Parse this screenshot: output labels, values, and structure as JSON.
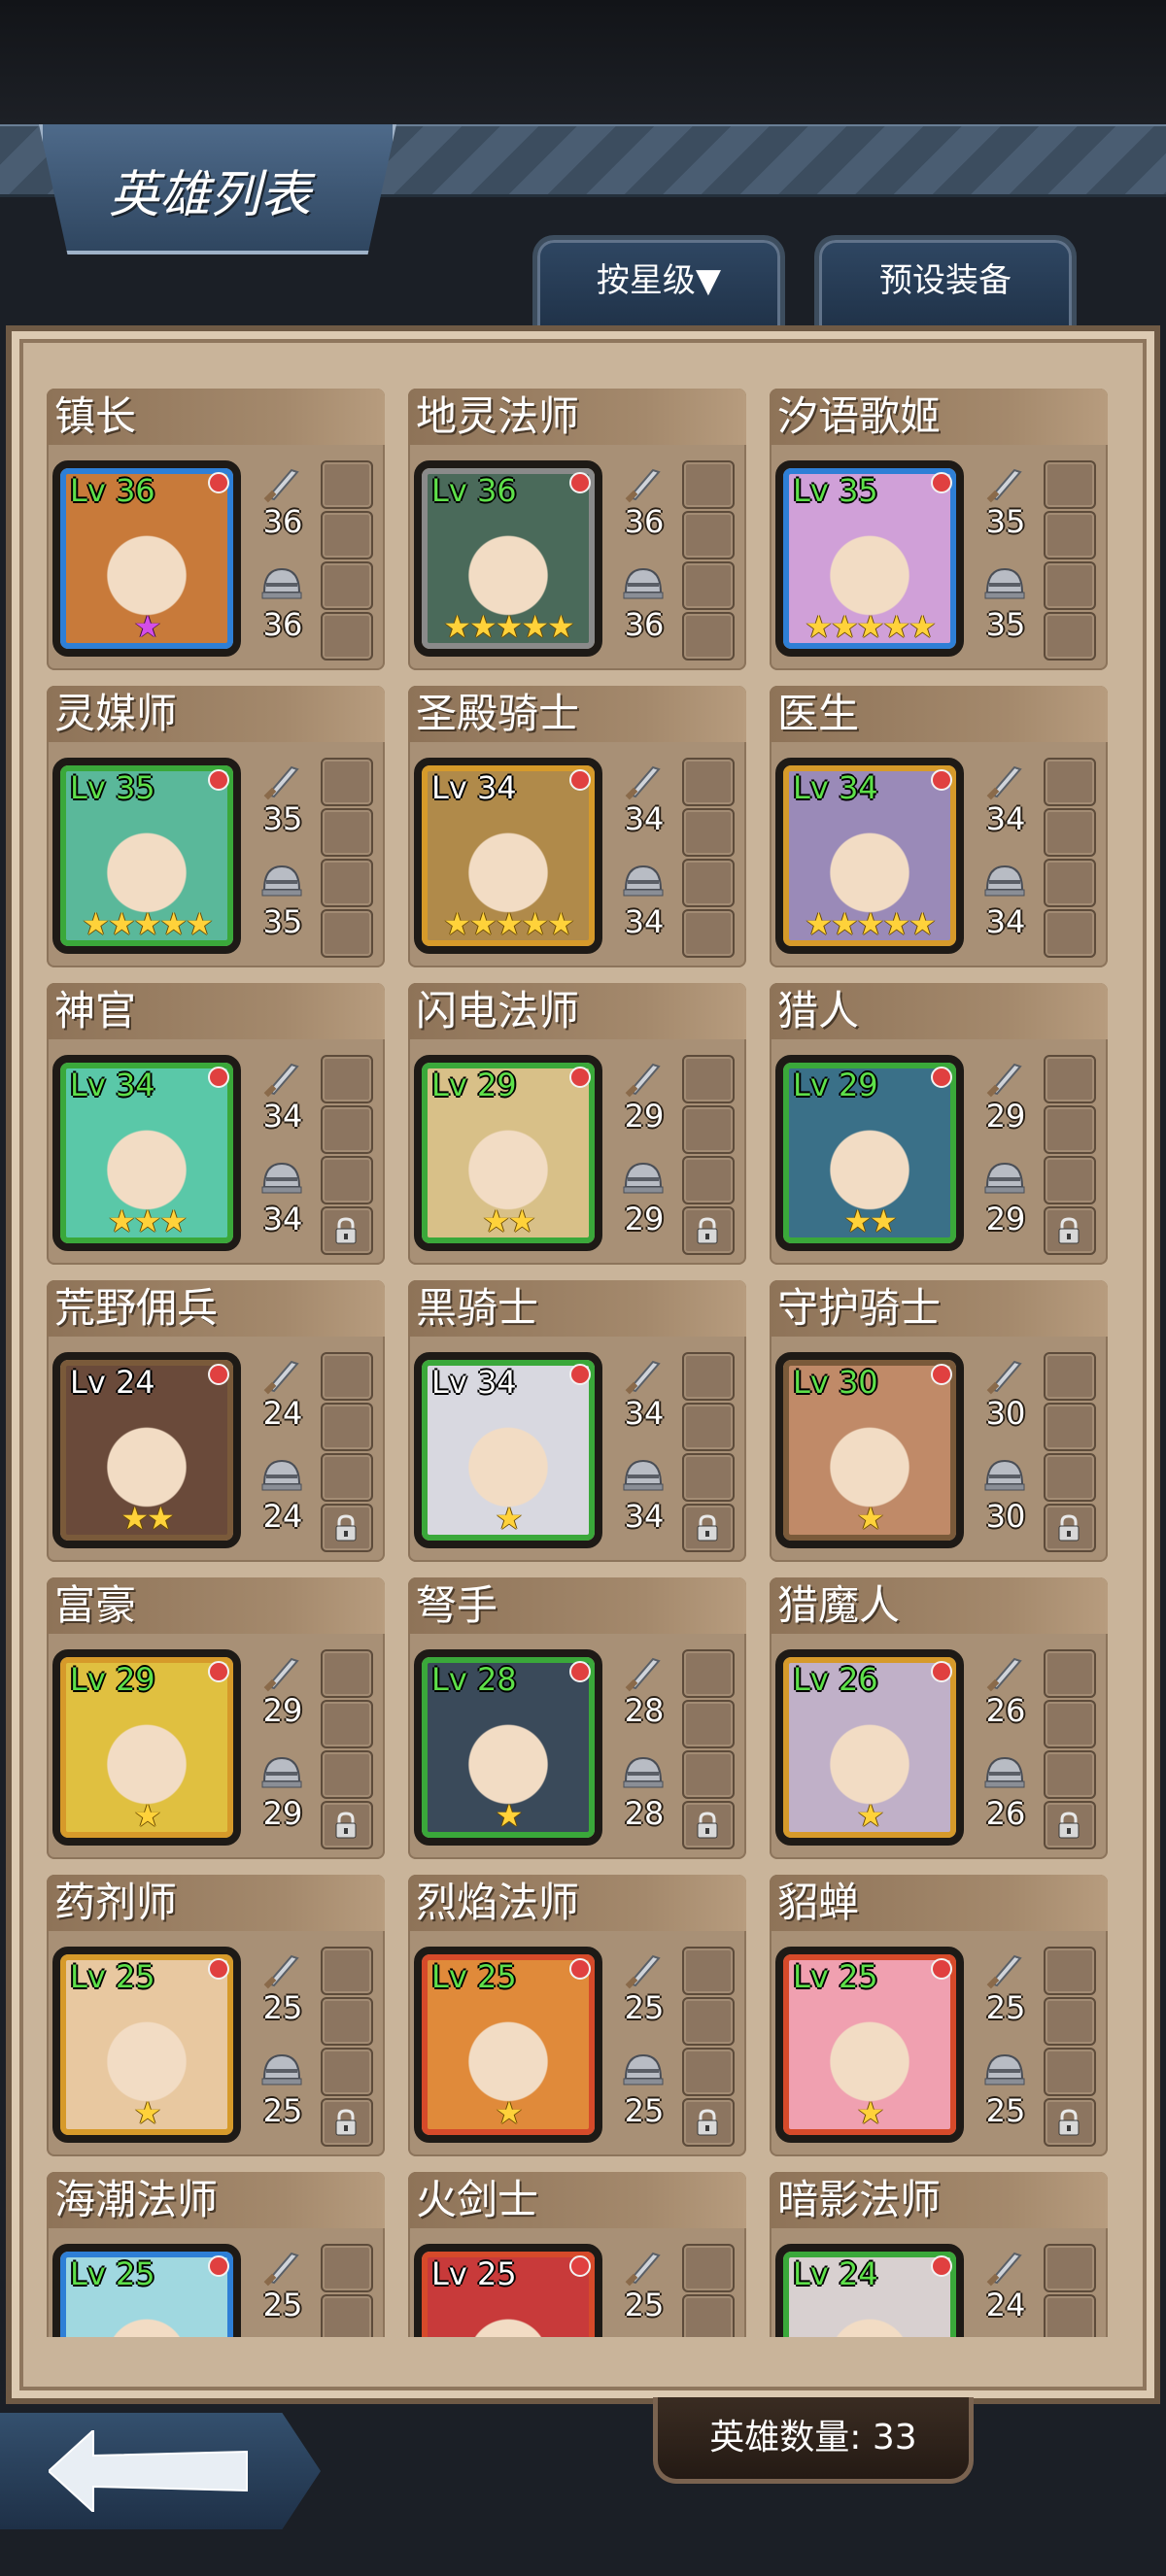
{
  "header": {
    "title": "英雄列表"
  },
  "tabs": {
    "sort_label": "按星级▼",
    "preset_label": "预设装备"
  },
  "heroes": [
    {
      "name": "镇长",
      "level": "Lv 36",
      "level_color": "green",
      "stars": 1,
      "star_color": "purple",
      "attack": "36",
      "defense": "36",
      "locked": false,
      "frame": "#2e7fd6",
      "bg": "#c87a3a"
    },
    {
      "name": "地灵法师",
      "level": "Lv 36",
      "level_color": "green",
      "stars": 5,
      "star_color": "gold",
      "attack": "36",
      "defense": "36",
      "locked": false,
      "frame": "#8a8a8a",
      "bg": "#4a6a5a"
    },
    {
      "name": "汐语歌姬",
      "level": "Lv 35",
      "level_color": "green",
      "stars": 5,
      "star_color": "gold",
      "attack": "35",
      "defense": "35",
      "locked": false,
      "frame": "#2e7fd6",
      "bg": "#d0a0d8"
    },
    {
      "name": "灵媒师",
      "level": "Lv 35",
      "level_color": "green",
      "stars": 5,
      "star_color": "gold",
      "attack": "35",
      "defense": "35",
      "locked": false,
      "frame": "#3aa83a",
      "bg": "#5ab89a"
    },
    {
      "name": "圣殿骑士",
      "level": "Lv 34",
      "level_color": "white",
      "stars": 5,
      "star_color": "gold",
      "attack": "34",
      "defense": "34",
      "locked": false,
      "frame": "#d69a2a",
      "bg": "#b08a4a"
    },
    {
      "name": "医生",
      "level": "Lv 34",
      "level_color": "green",
      "stars": 5,
      "star_color": "gold",
      "attack": "34",
      "defense": "34",
      "locked": false,
      "frame": "#d69a2a",
      "bg": "#9a8ab8"
    },
    {
      "name": "神官",
      "level": "Lv 34",
      "level_color": "green",
      "stars": 3,
      "star_color": "gold",
      "attack": "34",
      "defense": "34",
      "locked": true,
      "frame": "#3aa83a",
      "bg": "#5ac8a8"
    },
    {
      "name": "闪电法师",
      "level": "Lv 29",
      "level_color": "green",
      "stars": 2,
      "star_color": "gold",
      "attack": "29",
      "defense": "29",
      "locked": true,
      "frame": "#3aa83a",
      "bg": "#d8c088"
    },
    {
      "name": "猎人",
      "level": "Lv 29",
      "level_color": "green",
      "stars": 2,
      "star_color": "gold",
      "attack": "29",
      "defense": "29",
      "locked": true,
      "frame": "#3aa83a",
      "bg": "#3a7088"
    },
    {
      "name": "荒野佣兵",
      "level": "Lv 24",
      "level_color": "white",
      "stars": 2,
      "star_color": "gold",
      "attack": "24",
      "defense": "24",
      "locked": true,
      "frame": "#7a5a3a",
      "bg": "#6a4a3a"
    },
    {
      "name": "黑骑士",
      "level": "Lv 34",
      "level_color": "white",
      "stars": 1,
      "star_color": "gold",
      "attack": "34",
      "defense": "34",
      "locked": true,
      "frame": "#3aa83a",
      "bg": "#d8d8e0"
    },
    {
      "name": "守护骑士",
      "level": "Lv 30",
      "level_color": "green",
      "stars": 1,
      "star_color": "gold",
      "attack": "30",
      "defense": "30",
      "locked": true,
      "frame": "#7a5a3a",
      "bg": "#c08a68"
    },
    {
      "name": "富豪",
      "level": "Lv 29",
      "level_color": "green",
      "stars": 1,
      "star_color": "gold",
      "attack": "29",
      "defense": "29",
      "locked": true,
      "frame": "#d69a2a",
      "bg": "#e0c040"
    },
    {
      "name": "弩手",
      "level": "Lv 28",
      "level_color": "green",
      "stars": 1,
      "star_color": "gold",
      "attack": "28",
      "defense": "28",
      "locked": true,
      "frame": "#3aa83a",
      "bg": "#3a4a5a"
    },
    {
      "name": "猎魔人",
      "level": "Lv 26",
      "level_color": "green",
      "stars": 1,
      "star_color": "gold",
      "attack": "26",
      "defense": "26",
      "locked": true,
      "frame": "#d69a2a",
      "bg": "#c0b0c8"
    },
    {
      "name": "药剂师",
      "level": "Lv 25",
      "level_color": "green",
      "stars": 1,
      "star_color": "gold",
      "attack": "25",
      "defense": "25",
      "locked": true,
      "frame": "#d69a2a",
      "bg": "#e8c8a0"
    },
    {
      "name": "烈焰法师",
      "level": "Lv 25",
      "level_color": "green",
      "stars": 1,
      "star_color": "gold",
      "attack": "25",
      "defense": "25",
      "locked": true,
      "frame": "#d64a2a",
      "bg": "#e08a3a"
    },
    {
      "name": "貂蝉",
      "level": "Lv 25",
      "level_color": "green",
      "stars": 1,
      "star_color": "gold",
      "attack": "25",
      "defense": "25",
      "locked": true,
      "frame": "#d64a2a",
      "bg": "#f0a0b0"
    },
    {
      "name": "海潮法师",
      "level": "Lv 25",
      "level_color": "green",
      "stars": 0,
      "star_color": "gold",
      "attack": "25",
      "defense": "",
      "locked": false,
      "frame": "#2e7fd6",
      "bg": "#a0d8e0"
    },
    {
      "name": "火剑士",
      "level": "Lv 25",
      "level_color": "white",
      "stars": 0,
      "star_color": "gold",
      "attack": "25",
      "defense": "",
      "locked": false,
      "frame": "#d64a2a",
      "bg": "#c83a3a"
    },
    {
      "name": "暗影法师",
      "level": "Lv 24",
      "level_color": "green",
      "stars": 0,
      "star_color": "gold",
      "attack": "24",
      "defense": "",
      "locked": false,
      "frame": "#3aa83a",
      "bg": "#d8d0d0"
    }
  ],
  "icons": {
    "attack": "sword-icon",
    "defense": "helmet-icon",
    "lock": "lock-icon",
    "back": "back-arrow-icon"
  },
  "footer": {
    "hero_count": "英雄数量: 33"
  }
}
